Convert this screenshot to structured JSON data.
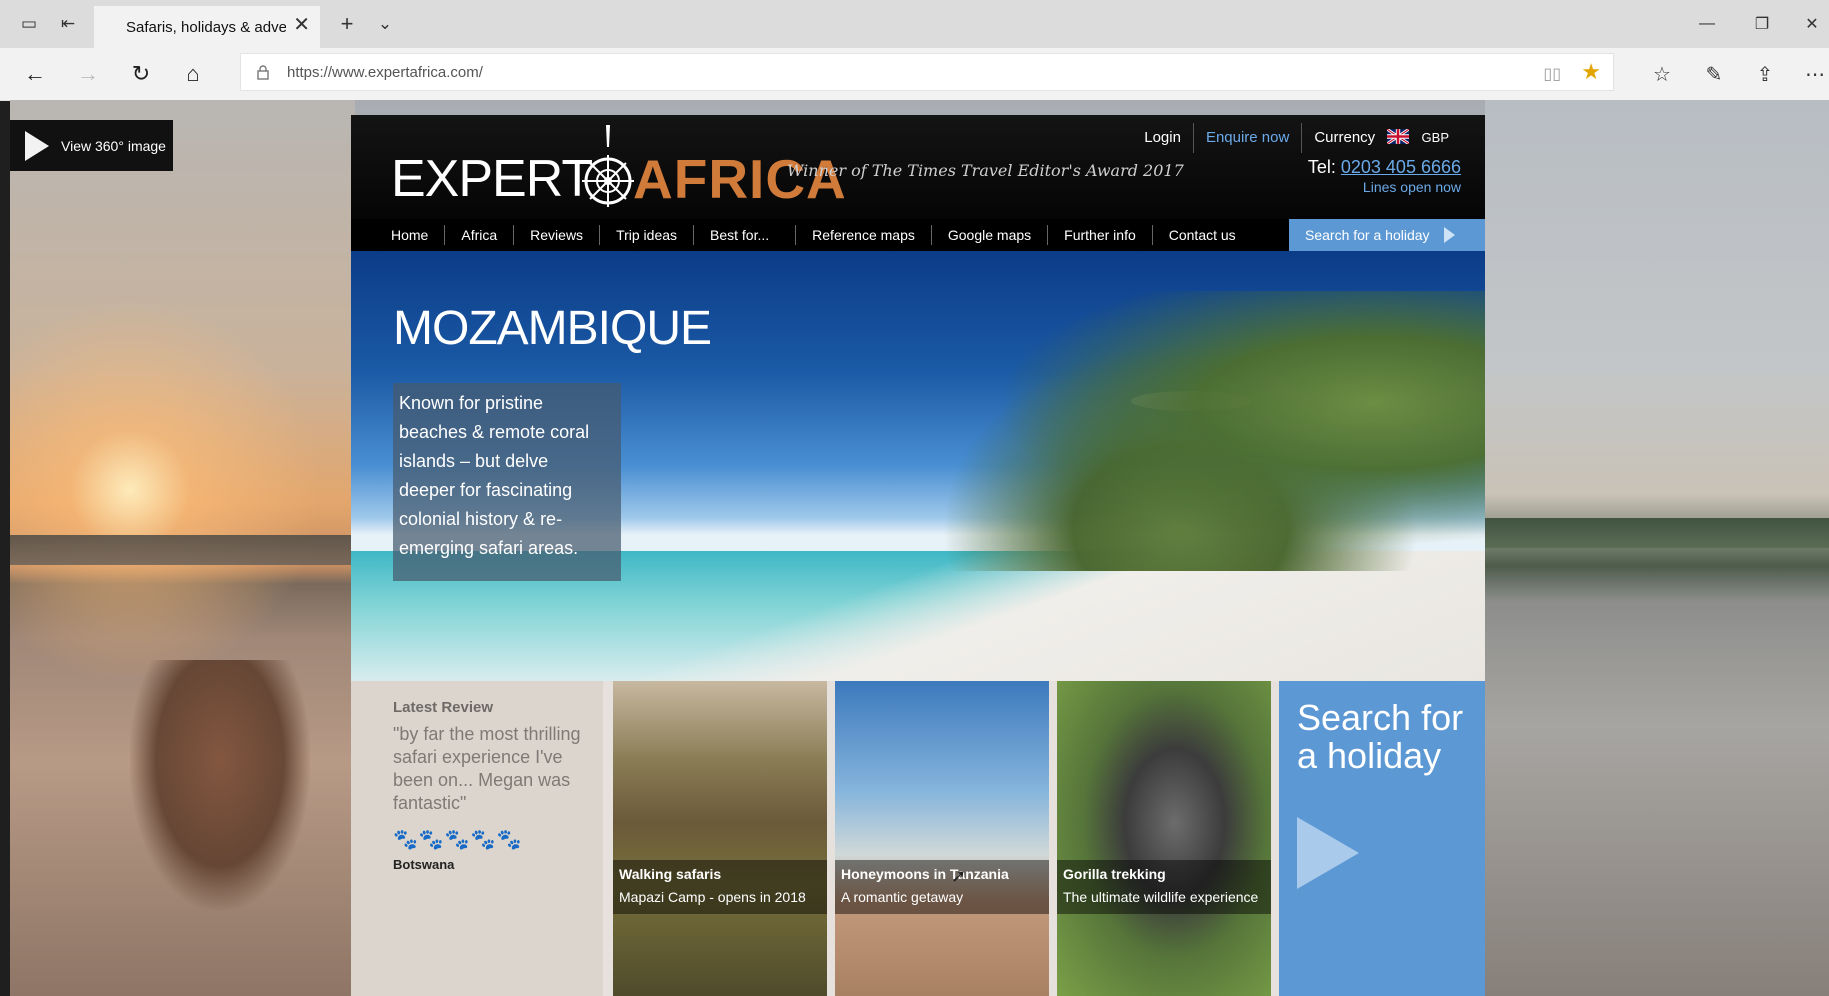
{
  "browser": {
    "tab_title": "Safaris, holidays & adve",
    "url": "https://www.expertafrica.com/",
    "icons": [
      "tab-aside-icon",
      "tab-back-icon",
      "close-icon",
      "new-tab-icon",
      "tab-list-icon",
      "minimize-icon",
      "restore-icon",
      "window-close-icon",
      "back-icon",
      "forward-icon",
      "refresh-icon",
      "home-icon",
      "lock-icon",
      "reading-view-icon",
      "favorite-star-icon",
      "favorites-icon",
      "pen-icon",
      "share-icon",
      "more-icon"
    ]
  },
  "page": {
    "view360_label": "View 360° image",
    "logo": {
      "expert": "EXPERT",
      "africa": "AFRICA"
    },
    "award": "Winner of The Times Travel Editor's Award 2017",
    "toplinks": {
      "login": "Login",
      "enquire": "Enquire now",
      "currency": "Currency",
      "currency_code": "GBP"
    },
    "tel_label": "Tel:",
    "tel_number": "0203 405 6666",
    "lines_open": "Lines open now",
    "nav": [
      "Home",
      "Africa",
      "Reviews",
      "Trip ideas",
      "Best for...",
      "Reference maps",
      "Google maps",
      "Further info",
      "Contact us"
    ],
    "nav_search": "Search for a holiday",
    "hero": {
      "title": "MOZAMBIQUE",
      "text": "Known for pristine beaches & remote coral islands – but delve deeper for fascinating colonial history & re-emerging safari areas."
    },
    "review": {
      "heading": "Latest Review",
      "quote": "\"by far the most thrilling safari experience I've been on... Megan was fantastic\"",
      "rating": 5,
      "place": "Botswana"
    },
    "tiles": [
      {
        "title": "Walking safaris",
        "sub": "Mapazi Camp - opens in 2018"
      },
      {
        "title": "Honeymoons in Tanzania",
        "sub": "A romantic getaway"
      },
      {
        "title": "Gorilla trekking",
        "sub": "The ultimate wildlife experience"
      }
    ],
    "search_tile": "Search for a holiday",
    "colors": {
      "accent_blue": "#5c98d4",
      "link_blue": "#6aa9e8",
      "brand_orange": "#d17b3a"
    }
  }
}
